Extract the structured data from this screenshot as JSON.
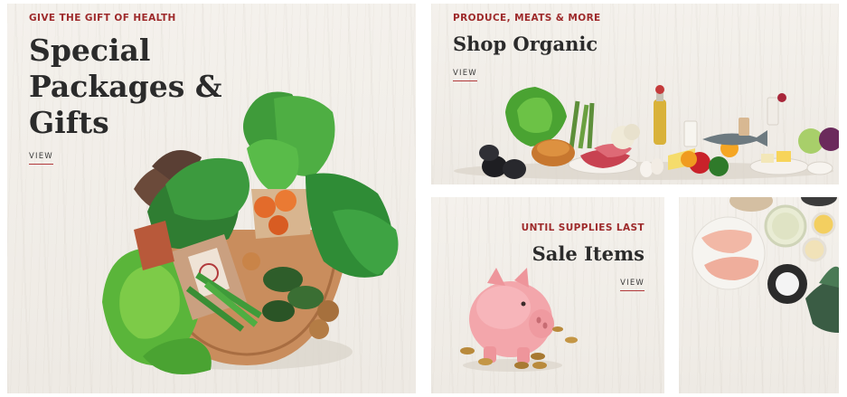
{
  "tiles": {
    "gifts": {
      "eyebrow": "GIVE THE GIFT OF HEALTH",
      "title_lines": [
        "Special",
        "Packages &",
        "Gifts"
      ],
      "link": "VIEW"
    },
    "organic": {
      "eyebrow": "PRODUCE, MEATS & MORE",
      "title": "Shop Organic",
      "link": "VIEW"
    },
    "sale": {
      "eyebrow": "UNTIL SUPPLIES LAST",
      "title": "Sale Items",
      "link": "VIEW"
    }
  },
  "colors": {
    "accent": "#9e2a2b",
    "heading": "#2b2b2b",
    "background": "#f2efea"
  }
}
